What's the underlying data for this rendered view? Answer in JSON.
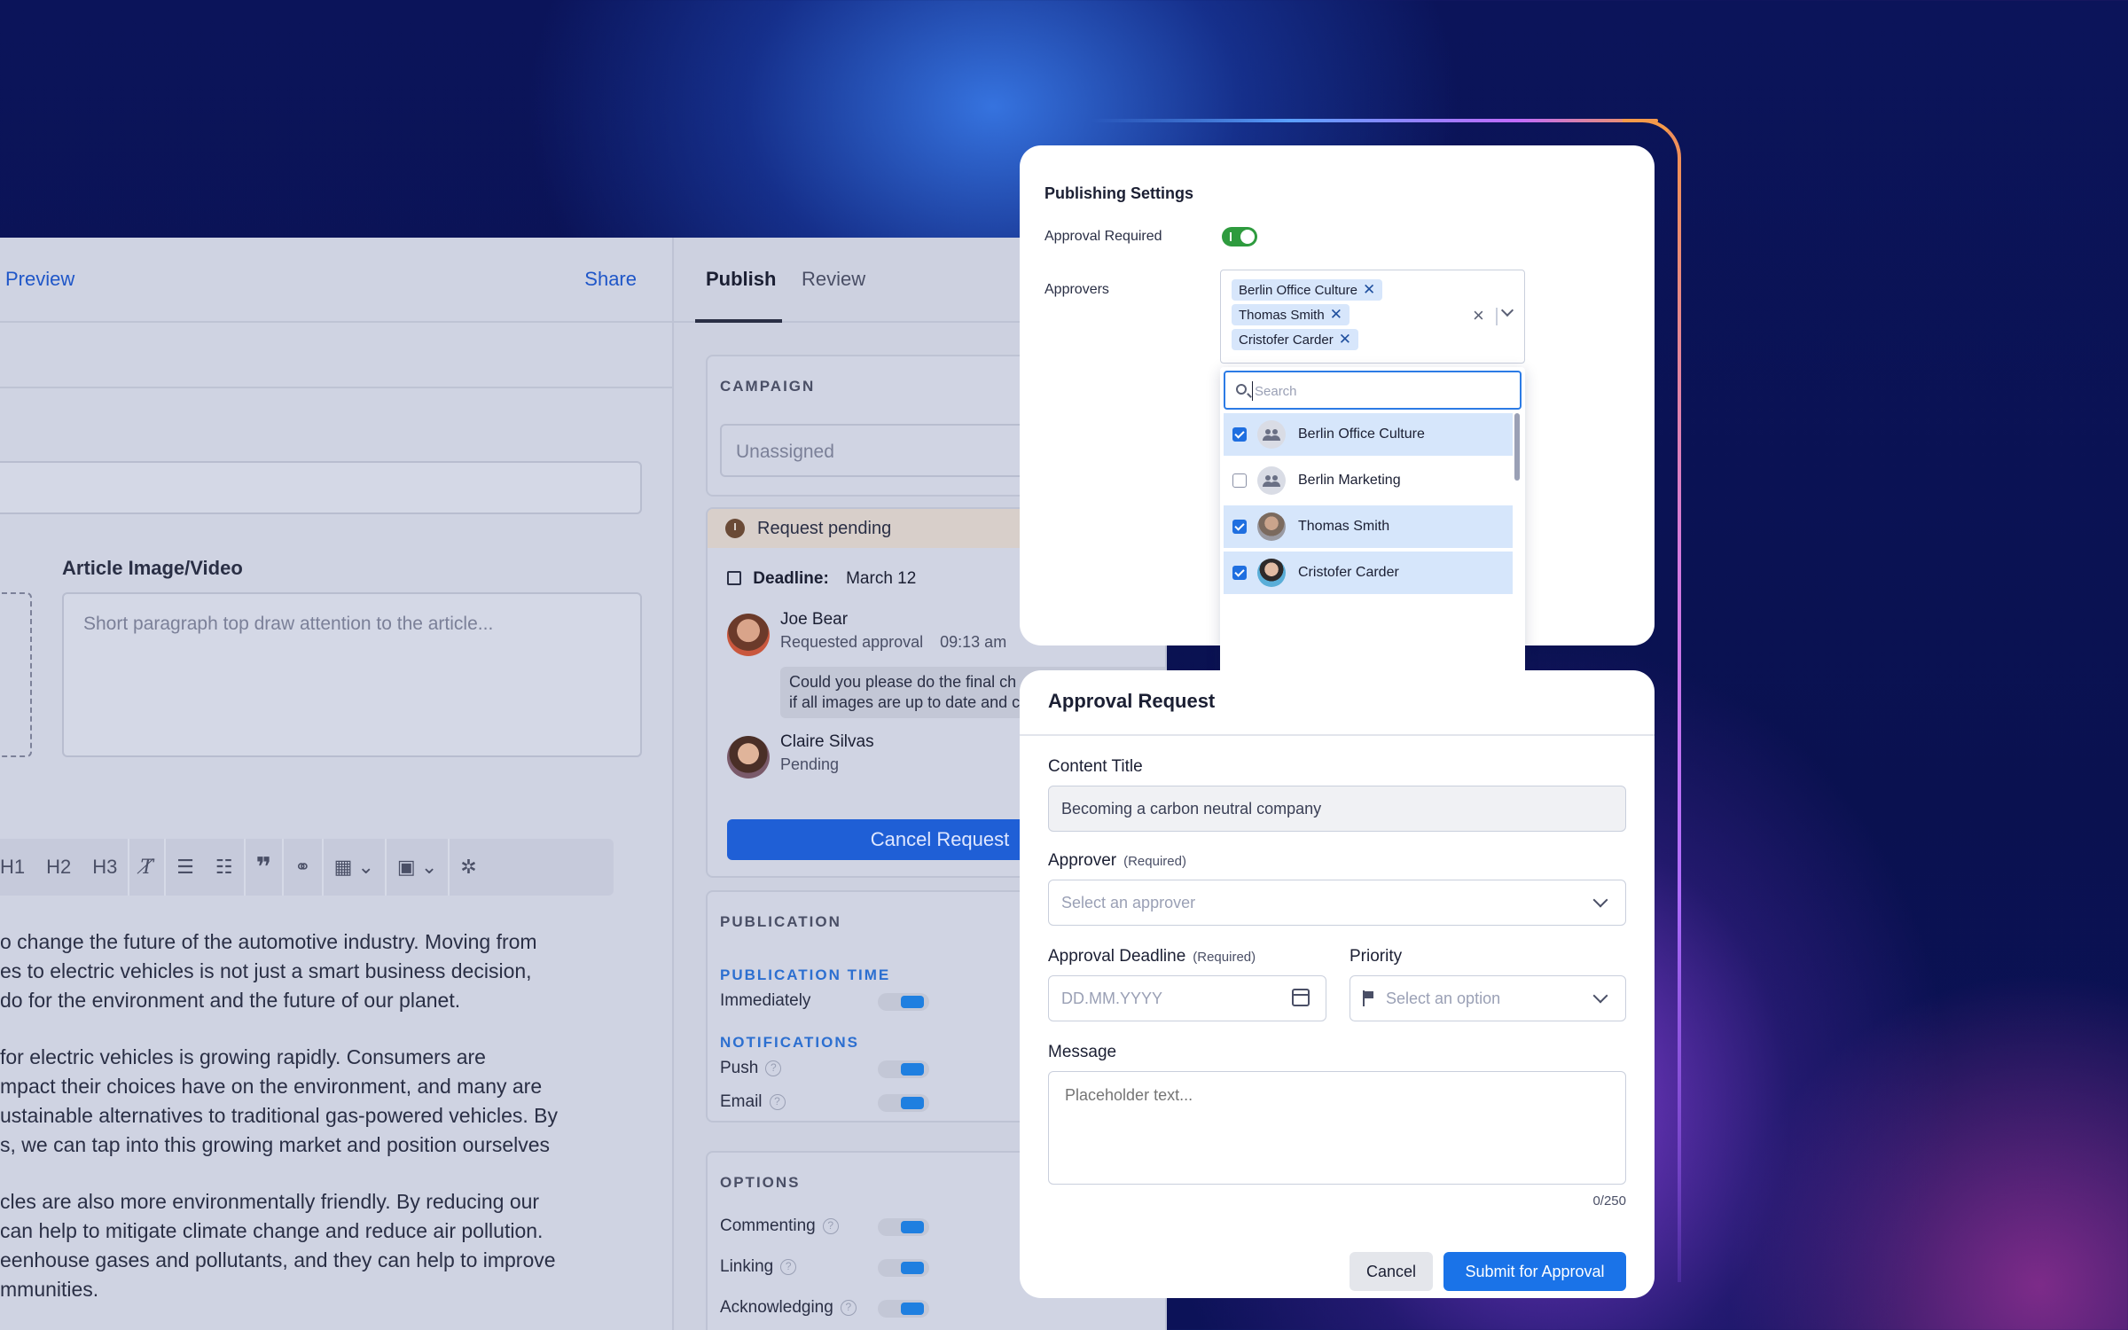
{
  "editor": {
    "preview_label": "Preview",
    "share_label": "Share",
    "media_label": "Article Image/Video",
    "media_placeholder": "Short paragraph top draw attention to the article...",
    "toolbar": [
      "H1",
      "H2",
      "H3"
    ],
    "paragraphs": [
      [
        "o change the future of the automotive industry. Moving from",
        "es to electric vehicles is not just a smart business decision,",
        "do for the environment and the future of our planet."
      ],
      [
        "for electric vehicles is growing rapidly. Consumers are",
        "mpact their choices have on the environment, and many are",
        "ustainable alternatives to traditional gas-powered vehicles. By",
        "s, we can tap into this growing market and position ourselves"
      ],
      [
        "cles are also more environmentally friendly. By reducing our",
        " can help to mitigate climate change and reduce air pollution.",
        "eenhouse gases and pollutants, and they can help to improve",
        "mmunities."
      ]
    ]
  },
  "publish_panel": {
    "tabs": [
      "Publish",
      "Review"
    ],
    "campaign_label": "CAMPAIGN",
    "campaign_value": "Unassigned",
    "pending_label": "Request pending",
    "deadline_label": "Deadline:",
    "deadline_value": "March 12",
    "requester_name": "Joe Bear",
    "requester_action": "Requested approval",
    "requester_time": "09:13 am",
    "message_line1": "Could you please do the final ch",
    "message_line2": "if all images are up to date and c",
    "reviewer_name": "Claire Silvas",
    "reviewer_status": "Pending",
    "cancel_request_label": "Cancel Request",
    "publication_label": "PUBLICATION",
    "publication_time_label": "PUBLICATION TIME",
    "immediately_label": "Immediately",
    "notifications_label": "NOTIFICATIONS",
    "push_label": "Push",
    "email_label": "Email",
    "options_label": "OPTIONS",
    "commenting_label": "Commenting",
    "linking_label": "Linking",
    "acknowledging_label": "Acknowledging"
  },
  "settings": {
    "title": "Publishing Settings",
    "approval_required_label": "Approval Required",
    "approvers_label": "Approvers",
    "chips": [
      "Berlin Office Culture",
      "Thomas Smith",
      "Cristofer Carder"
    ],
    "search_placeholder": "Search",
    "options": [
      {
        "label": "Berlin Office Culture",
        "checked": true,
        "icon": "group-icon"
      },
      {
        "label": "Berlin Marketing",
        "checked": false,
        "icon": "group-icon"
      },
      {
        "label": "Thomas Smith",
        "checked": true,
        "icon": "avatar"
      },
      {
        "label": "Cristofer Carder",
        "checked": true,
        "icon": "avatar"
      }
    ]
  },
  "approval": {
    "title": "Approval Request",
    "content_title_label": "Content Title",
    "content_title_value": "Becoming a carbon neutral company",
    "approver_label": "Approver",
    "required_label": "(Required)",
    "approver_placeholder": "Select an approver",
    "deadline_label": "Approval Deadline",
    "deadline_placeholder": "DD.MM.YYYY",
    "priority_label": "Priority",
    "priority_placeholder": "Select an option",
    "message_label": "Message",
    "message_placeholder": "Placeholder text...",
    "counter": "0/250",
    "cancel_label": "Cancel",
    "submit_label": "Submit for Approval"
  },
  "colors": {
    "accent_blue": "#1a73e8",
    "toggle_green": "#2e9b3e",
    "chip_blue": "#d7e6fb"
  }
}
